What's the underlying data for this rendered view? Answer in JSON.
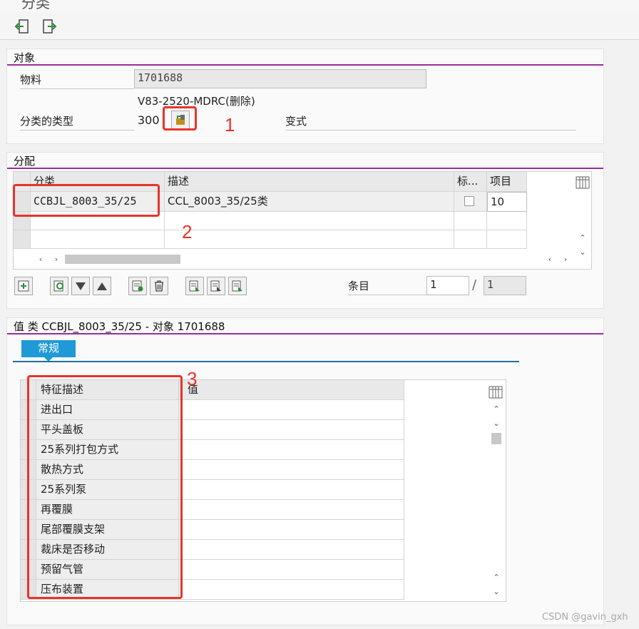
{
  "app": {
    "title": "分类"
  },
  "toolbar": {
    "back_icon": "exit-left-icon",
    "forward_icon": "exit-right-icon"
  },
  "object_section": {
    "title": "对象",
    "material_label": "物料",
    "material_value": "1701688",
    "material_desc": "V83-2520-MDRC(删除)",
    "class_type_label": "分类的类型",
    "class_type_value": "300",
    "variant_label": "变式"
  },
  "assign_section": {
    "title": "分配",
    "columns": [
      "分类",
      "描述",
      "标...",
      "项目"
    ],
    "rows": [
      {
        "class": "CCBJL_8003_35/25",
        "desc": "CCL_8003_35/25类",
        "item": "10"
      }
    ],
    "entry_label": "条目",
    "entry_current": "1",
    "entry_sep": "/",
    "entry_total": "1"
  },
  "values_section": {
    "title": "值 类 CCBJL_8003_35/25 - 对象 1701688",
    "tab": "常规",
    "columns": [
      "特征描述",
      "值"
    ],
    "rows": [
      "进出口",
      "平头盖板",
      "25系列打包方式",
      "散热方式",
      "25系列泵",
      "再覆膜",
      "尾部覆膜支架",
      "裁床是否移动",
      "预留气管",
      "压布装置"
    ]
  },
  "annotations": {
    "n1": "1",
    "n2": "2",
    "n3": "3"
  },
  "watermark": "CSDN @gavin_gxh",
  "colors": {
    "accent_line": "#9b2c9e",
    "tab_blue": "#1f9ad6",
    "annotation_red": "#e8332a"
  }
}
